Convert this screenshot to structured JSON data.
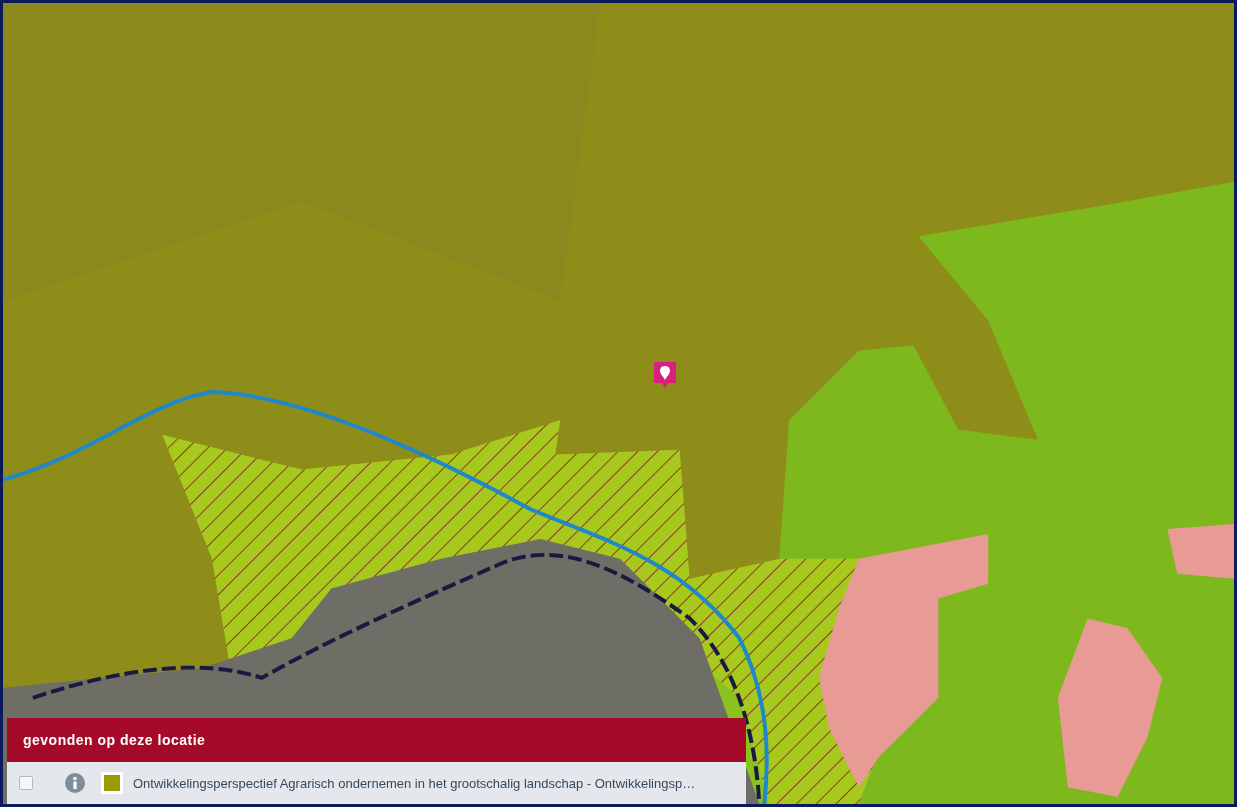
{
  "panel": {
    "title": "gevonden op deze locatie",
    "items": [
      {
        "checked": false,
        "color": "#9c9a00",
        "label": "Ontwikkelingsperspectief Agrarisch ondernemen in het grootschalig landschap - Ontwikkelingsp…"
      }
    ]
  }
}
